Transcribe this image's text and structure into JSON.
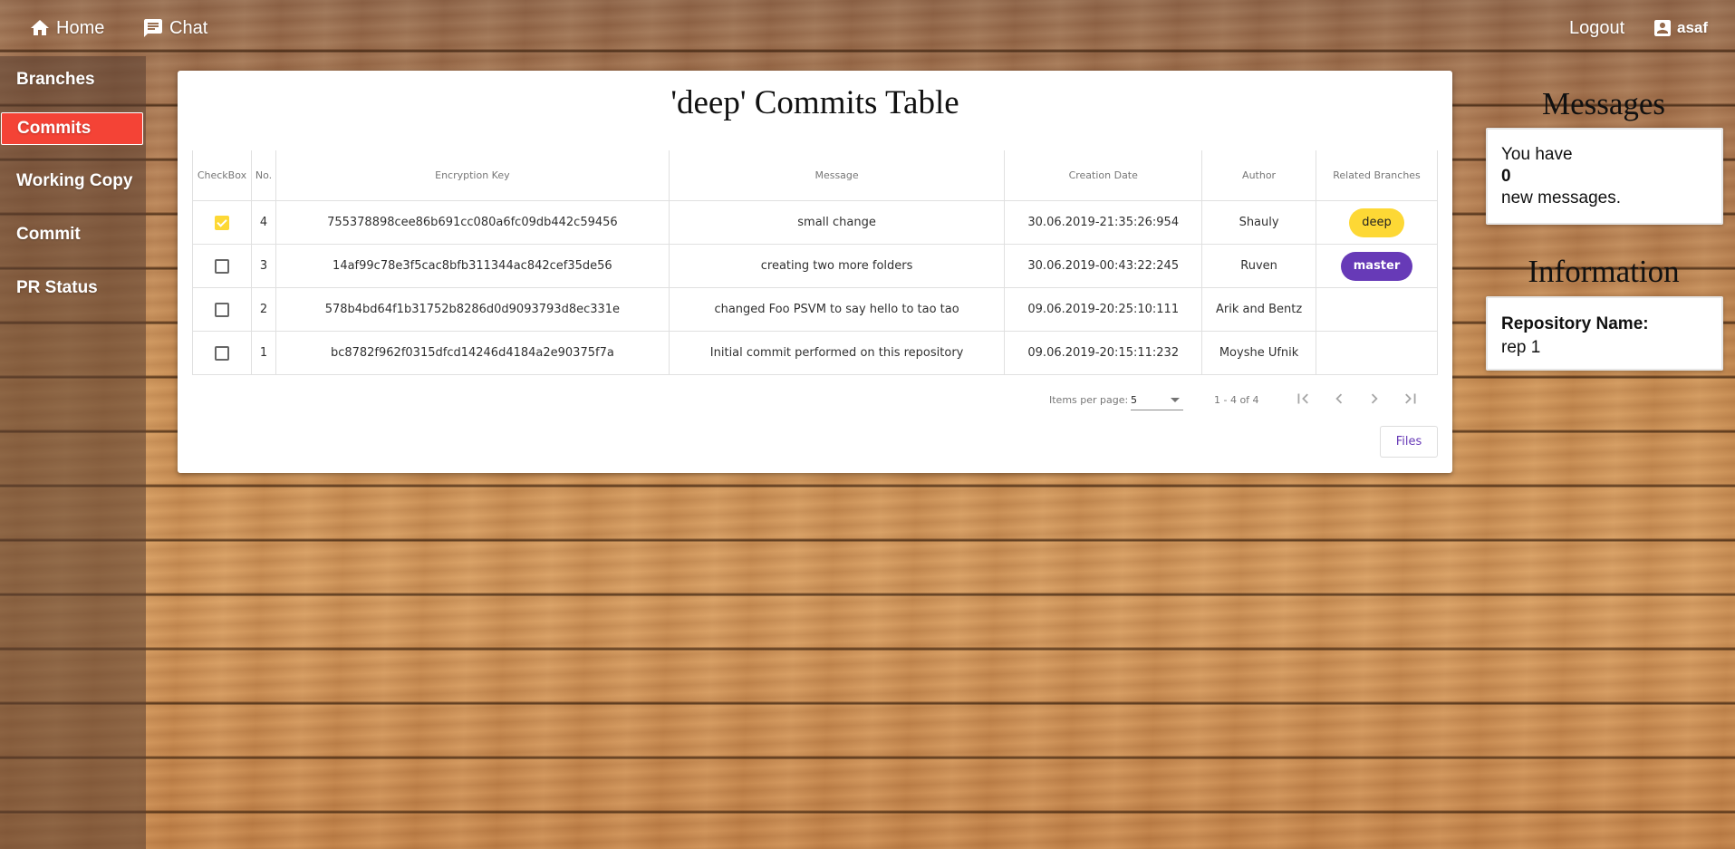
{
  "topbar": {
    "home_label": "Home",
    "chat_label": "Chat",
    "logout_label": "Logout",
    "user_label": "asaf"
  },
  "sidebar": {
    "items": [
      {
        "label": "Branches",
        "active": false
      },
      {
        "label": "Commits",
        "active": true
      },
      {
        "label": "Working Copy",
        "active": false
      },
      {
        "label": "Commit",
        "active": false
      },
      {
        "label": "PR Status",
        "active": false
      }
    ]
  },
  "card": {
    "title": "'deep' Commits Table",
    "columns": [
      "CheckBox",
      "No.",
      "Encryption Key",
      "Message",
      "Creation Date",
      "Author",
      "Related Branches"
    ],
    "rows": [
      {
        "checked": true,
        "no": "4",
        "key": "755378898cee86b691cc080a6fc09db442c59456",
        "message": "small change",
        "date": "30.06.2019-21:35:26:954",
        "author": "Shauly",
        "branch": "deep"
      },
      {
        "checked": false,
        "no": "3",
        "key": "14af99c78e3f5cac8bfb311344ac842cef35de56",
        "message": "creating two more folders",
        "date": "30.06.2019-00:43:22:245",
        "author": "Ruven",
        "branch": "master"
      },
      {
        "checked": false,
        "no": "2",
        "key": "578b4bd64f1b31752b8286d0d9093793d8ec331e",
        "message": "changed Foo PSVM to say hello to tao tao",
        "date": "09.06.2019-20:25:10:111",
        "author": "Arik and Bentz",
        "branch": ""
      },
      {
        "checked": false,
        "no": "1",
        "key": "bc8782f962f0315dfcd14246d4184a2e90375f7a",
        "message": "Initial commit performed on this repository",
        "date": "09.06.2019-20:15:11:232",
        "author": "Moyshe Ufnik",
        "branch": ""
      }
    ],
    "paginator": {
      "items_per_page_label": "Items per page:",
      "items_per_page_value": "5",
      "range_label": "1 - 4 of 4"
    },
    "files_button": "Files"
  },
  "messages": {
    "title": "Messages",
    "line1": "You have",
    "count": "0",
    "line2": "new messages."
  },
  "information": {
    "title": "Information",
    "repo_label": "Repository Name:",
    "repo_value": "rep 1"
  },
  "colors": {
    "active_nav": "#f44336",
    "deep_chip": "#fdd835",
    "master_chip": "#673ab7"
  }
}
